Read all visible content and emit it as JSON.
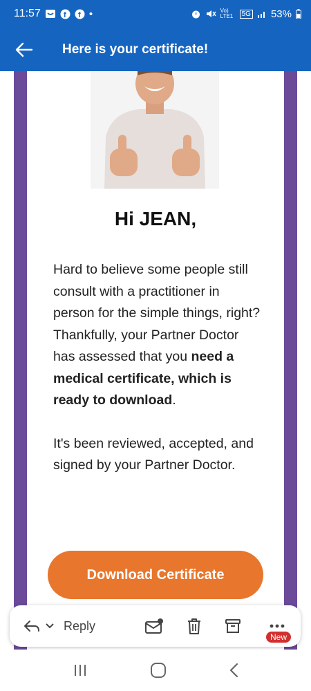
{
  "status_bar": {
    "time": "11:57",
    "battery": "53%",
    "network": "5G",
    "volte": "Vo) LTE1"
  },
  "app_bar": {
    "title": "Here is your certificate!"
  },
  "email": {
    "greeting": "Hi JEAN,",
    "para1": "Hard to believe some people still consult with a practitioner in person for the simple things, right?",
    "para2_start": "Thankfully, your Partner Doctor has assessed that you ",
    "para2_bold": "need a medical certificate, which is ready to download",
    "para2_end": ".",
    "para3": "It's been reviewed, accepted, and signed by your Partner Doctor.",
    "cta_label": "Download Certificate"
  },
  "action_bar": {
    "reply_label": "Reply",
    "new_badge": "New"
  },
  "colors": {
    "primary": "#1565c0",
    "frame": "#6b4a9a",
    "cta": "#e8762d",
    "badge": "#d32f2f"
  },
  "icons": [
    "back-arrow-icon",
    "reply-icon",
    "chevron-down-icon",
    "mark-unread-icon",
    "trash-icon",
    "archive-icon",
    "more-icon",
    "recents-icon",
    "home-icon",
    "back-icon"
  ]
}
